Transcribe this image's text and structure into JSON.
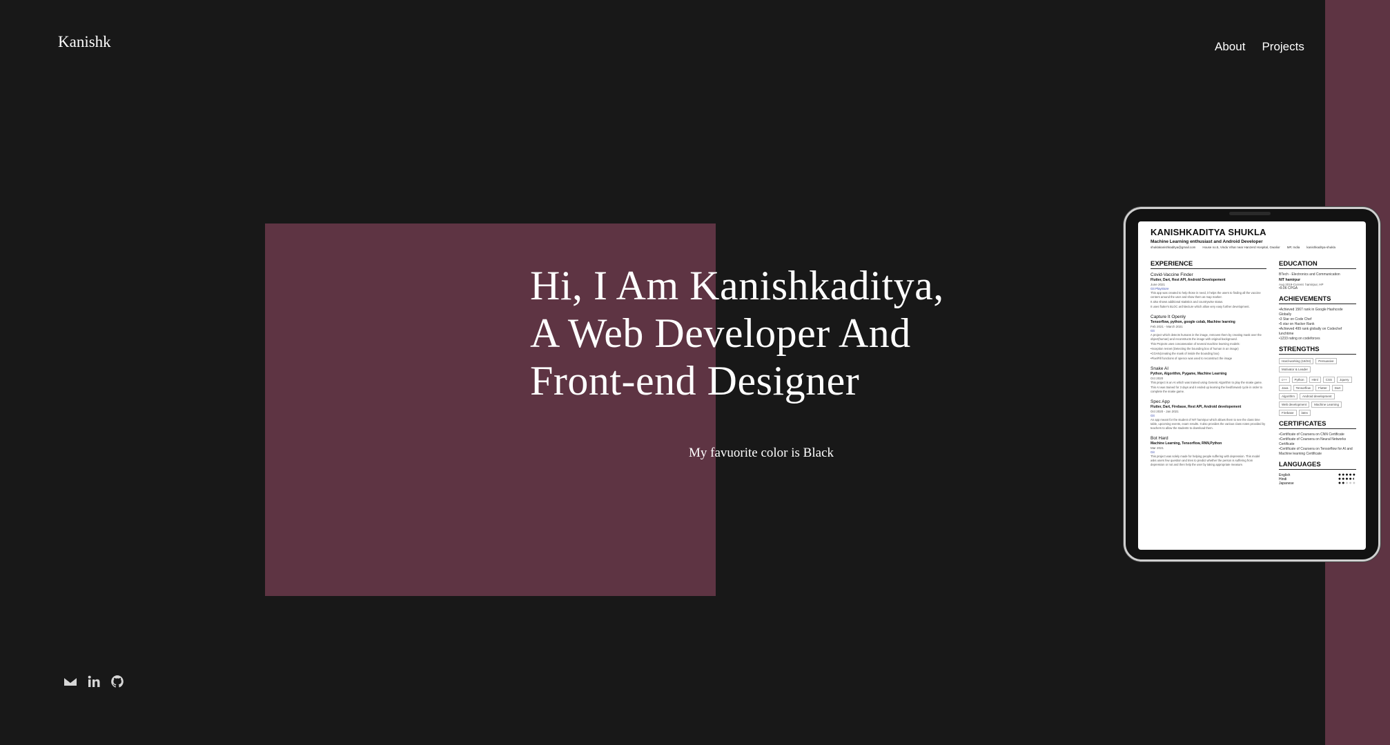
{
  "brand": {
    "logo": "Kanishk"
  },
  "nav": {
    "items": [
      "About",
      "Projects"
    ]
  },
  "hero": {
    "title_lines": [
      "Hi, I Am Kanishkaditya,",
      "A Web Developer And",
      "Front-end Designer"
    ],
    "subtitle": "My favuorite color is Black"
  },
  "socials": [
    "envelope-icon",
    "linkedin-icon",
    "github-icon"
  ],
  "colors": {
    "background": "#181818",
    "accent": "#5e3443",
    "text": "#ffffff"
  },
  "resume": {
    "name": "KANISHKADITYA SHUKLA",
    "tagline": "Machine Learning enthusiast and Android Developer",
    "contact": [
      "shuklakanishkaditya@gmail.com",
      "House no.5, Vindu Vihar near Hanzerd Hospital, Gwalior",
      "MP, India",
      "kanishkaditya-shukla"
    ],
    "experience_title": "EXPERIENCE",
    "experience": [
      {
        "title": "Covid-Vaccine Finder",
        "stack": "Flutter, Dart, Rest API, Android Developement",
        "date": "June 2021",
        "links": "Git  PlayStore",
        "lines": [
          "This app was created to help those in need, it helps the users to finding all the vaccine centers around the user and show them as map marker.",
          "It also shows additional statistics and countrywise status.",
          "It uses flutter's BLOC architecture which allow very easy further development."
        ]
      },
      {
        "title": "Capture It Openly",
        "stack": "Tensorflow, python, google colab, Machine learning",
        "date": "Feb 2021 - March 2021",
        "links": "Git",
        "lines": [
          "A project which detects humans in the image, removes them by creating mask over the object(human) and reconstructs the image with original background.",
          "This Projects uses concatenation of several machine learning models:",
          "•Inception resnet (Detecting the bounding box of human in an image)",
          "•CGAN(creating the mask of inside the bounding box)",
          "•PixelFill functions of opencv was used to reconstruct the image"
        ]
      },
      {
        "title": "Snake AI",
        "stack": "Python, Algorithm, Pygame, Machine Learning",
        "date": "Oct 2020",
        "links": "",
        "lines": [
          "This project is an AI which was trained using Genetic Algorithm to play the snake game.",
          "This AI was trained for 3 days and it ended up learning the feedforward cycle in order to complete the snake game."
        ]
      },
      {
        "title": "Spec App",
        "stack": "Flutter, Dart, Firebase, Rest API, Android developement",
        "date": "Oct 2020 - Jan 2021",
        "links": "Git",
        "lines": [
          "An app meant for the student of NIT hamirpur which allows them to see the class time table, upcoming events, exam results. It also provides the various class notes provided by teachers to allow the students to download them."
        ]
      },
      {
        "title": "Bot Hard",
        "stack": "Machine Learning, Tensorflow, RNN,Python",
        "date": "Mar 2021",
        "links": "Git",
        "lines": [
          "This project was solely made for helping people suffering with depression. This model asks users few question and tries to predict whether the person is suffering from depression or not and then help the user by taking appropriate measure."
        ]
      }
    ],
    "education_title": "EDUCATION",
    "education": {
      "degree": "BTech - Electronics and Communication",
      "school": "NIT hamirpur",
      "date": "Aug 2019-Current",
      "place": "hamirpur, HP",
      "cgpa": "•9.06 CPGA"
    },
    "achievements_title": "ACHIEVEMENTS",
    "achievements": [
      "•Achieved 1567 rank in Google Hashcode Globally",
      "•3 Star on Code Chef",
      "•5 star on Hacker Rank",
      "•Achieved 499 rank globally on Codechef lunchtime",
      "•1233 rating on codeforces"
    ],
    "strengths_title": "STRENGTHS",
    "strengths": [
      "Hard-working (18/24)",
      "Persuasive",
      "Motivator & Leader"
    ],
    "skills": [
      "c++",
      "Python",
      "Html",
      "CSS",
      "Jquery",
      "Java",
      "Tensorflow",
      "Flutter",
      "Dart",
      "Algorithm",
      "Android development",
      "Web development",
      "Machine Learning",
      "Firebase",
      "latex"
    ],
    "certificates_title": "CERTIFICATES",
    "certificates": [
      "•Certificate of Coursera on CNN Certificate",
      "•Certificate of Coursera on Neural Networks Certificate",
      "•Certificate of Coursera on Tensorflow for AI and Machine learning  Certificate"
    ],
    "languages_title": "LANGUAGES",
    "languages": [
      "English",
      "Hindi",
      "Japanese"
    ]
  }
}
